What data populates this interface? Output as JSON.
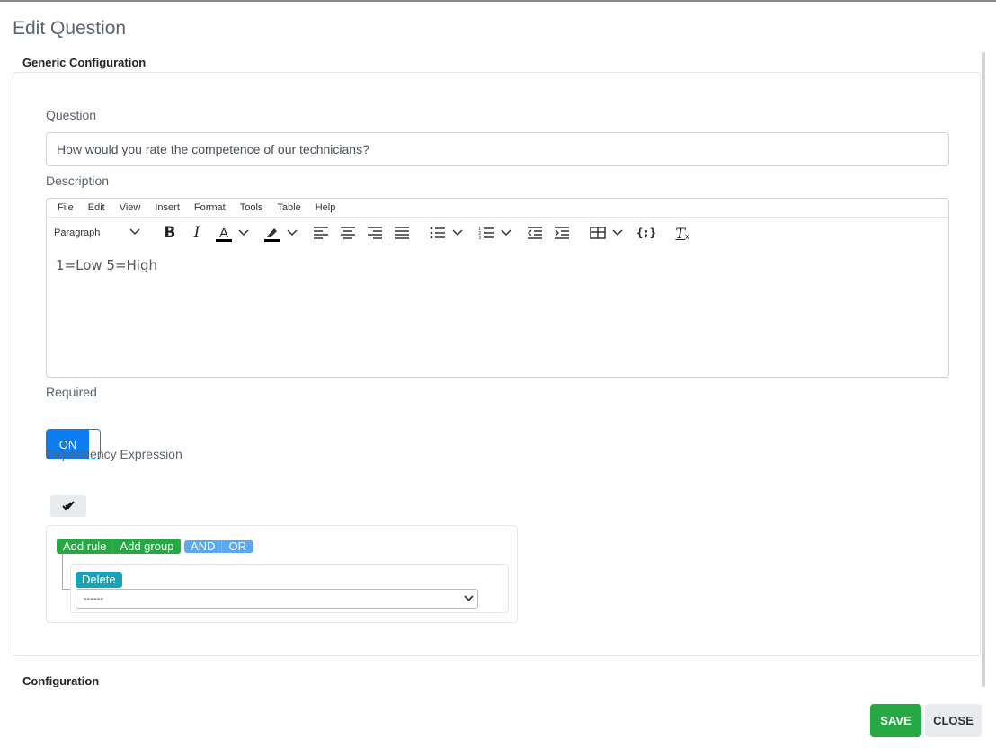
{
  "modal": {
    "title": "Edit Question"
  },
  "sections": {
    "generic": "Generic Configuration",
    "configuration": "Configuration"
  },
  "question": {
    "label": "Question",
    "value": "How would you rate the competence of our technicians?"
  },
  "description": {
    "label": "Description",
    "menu": [
      "File",
      "Edit",
      "View",
      "Insert",
      "Format",
      "Tools",
      "Table",
      "Help"
    ],
    "block_format": "Paragraph",
    "content": "1=Low   5=High"
  },
  "required": {
    "label": "Required",
    "toggle_text": "ON"
  },
  "dependency": {
    "label": "Dependency Expression",
    "add_rule": "Add rule",
    "add_group": "Add group",
    "and_label": "AND",
    "or_label": "OR",
    "delete_label": "Delete",
    "select_value": "------"
  },
  "footer": {
    "save_label": "SAVE",
    "close_label": "CLOSE"
  },
  "colors": {
    "primary": "#0d7cf2",
    "success": "#28a745",
    "info": "#17a2b8",
    "light_blue": "#5ba9f3"
  }
}
